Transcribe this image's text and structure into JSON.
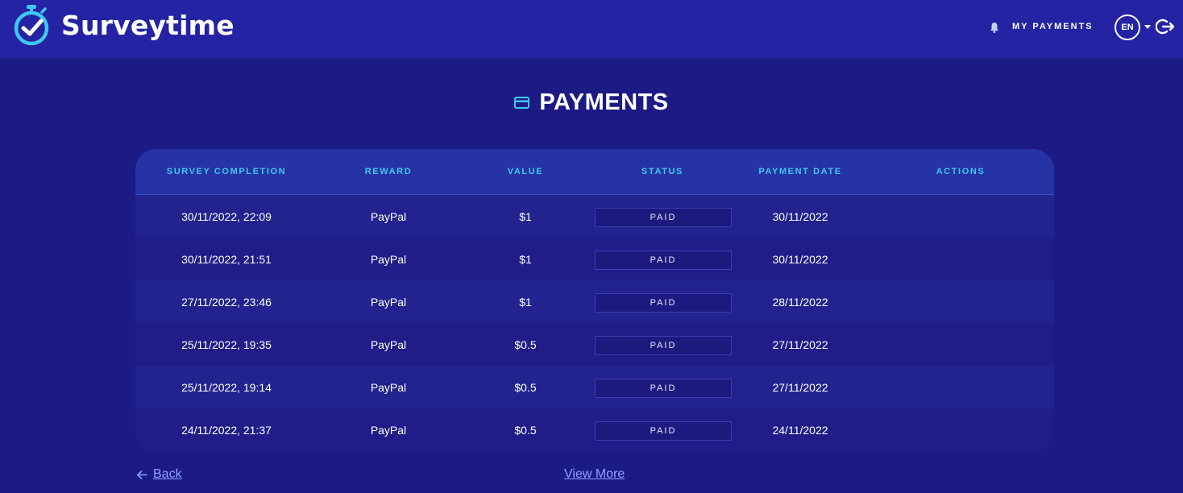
{
  "header": {
    "brand": "Surveytime",
    "nav_my_payments": "MY PAYMENTS",
    "language": "EN"
  },
  "page": {
    "title": "PAYMENTS"
  },
  "table": {
    "columns": [
      "SURVEY COMPLETION",
      "REWARD",
      "VALUE",
      "STATUS",
      "PAYMENT DATE",
      "ACTIONS"
    ],
    "rows": [
      {
        "completion": "30/11/2022, 22:09",
        "reward": "PayPal",
        "value": "$1",
        "status": "PAID",
        "payment_date": "30/11/2022"
      },
      {
        "completion": "30/11/2022, 21:51",
        "reward": "PayPal",
        "value": "$1",
        "status": "PAID",
        "payment_date": "30/11/2022"
      },
      {
        "completion": "27/11/2022, 23:46",
        "reward": "PayPal",
        "value": "$1",
        "status": "PAID",
        "payment_date": "28/11/2022"
      },
      {
        "completion": "25/11/2022, 19:35",
        "reward": "PayPal",
        "value": "$0.5",
        "status": "PAID",
        "payment_date": "27/11/2022"
      },
      {
        "completion": "25/11/2022, 19:14",
        "reward": "PayPal",
        "value": "$0.5",
        "status": "PAID",
        "payment_date": "27/11/2022"
      },
      {
        "completion": "24/11/2022, 21:37",
        "reward": "PayPal",
        "value": "$0.5",
        "status": "PAID",
        "payment_date": "24/11/2022"
      }
    ]
  },
  "footer": {
    "back_label": "Back",
    "view_more_label": "View More"
  },
  "icons": {
    "logo": "stopwatch-check-icon",
    "bell": "bell-icon",
    "caret": "caret-down-icon",
    "logout": "logout-icon",
    "title": "credit-card-icon",
    "back": "arrow-left-icon"
  },
  "colors": {
    "background": "#1c1a85",
    "header": "#2423a4",
    "accent": "#3fc8f0",
    "link": "#8fa0ff"
  }
}
